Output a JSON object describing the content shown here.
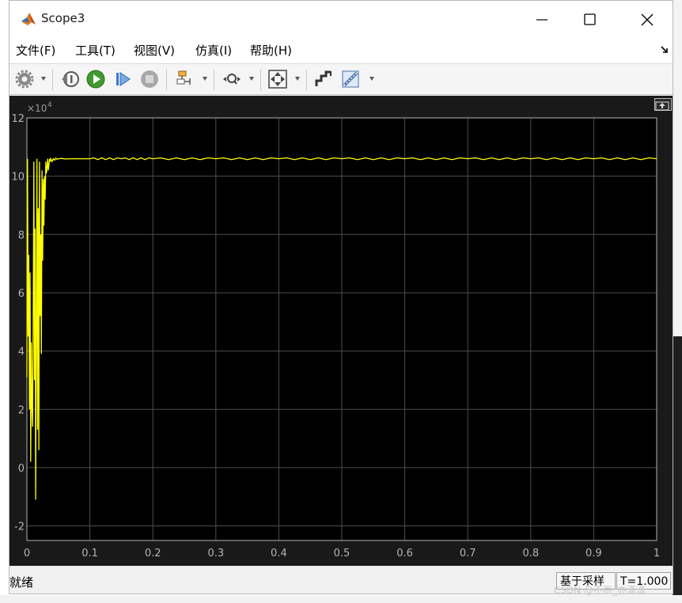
{
  "window": {
    "title": "Scope3",
    "controls": [
      "minimize",
      "maximize",
      "close"
    ]
  },
  "menu": {
    "items": [
      {
        "label": "文件(F)"
      },
      {
        "label": "工具(T)"
      },
      {
        "label": "视图(V)"
      },
      {
        "label": "仿真(I)"
      },
      {
        "label": "帮助(H)"
      }
    ]
  },
  "toolbar": {
    "buttons": [
      "gear-icon",
      "step-back-icon",
      "run-icon",
      "step-forward-icon",
      "stop-icon",
      "signal-selector-icon",
      "zoom-icon",
      "autoscale-icon",
      "highlight-icon",
      "measure-icon"
    ]
  },
  "status": {
    "text": "就绪",
    "sample_mode": "基于采样",
    "time": "T=1.000"
  },
  "watermark": "CSDN @不雨_亦潇潇",
  "chart_data": {
    "type": "line",
    "title": "",
    "xlabel": "",
    "ylabel": "",
    "y_exponent_label": "×10",
    "y_exponent_power": "4",
    "xlim": [
      0,
      1
    ],
    "ylim": [
      -2.5,
      12
    ],
    "x_ticks": [
      "0",
      "0.1",
      "0.2",
      "0.3",
      "0.4",
      "0.5",
      "0.6",
      "0.7",
      "0.8",
      "0.9",
      "1"
    ],
    "y_ticks": [
      "-2",
      "0",
      "2",
      "4",
      "6",
      "8",
      "10",
      "12"
    ],
    "grid": true,
    "background": "#000000",
    "axes_color": "#b3b3b3",
    "line_color": "#ffff00",
    "series": [
      {
        "x": [
          0,
          0.001,
          0.002,
          0.003,
          0.004,
          0.005,
          0.006,
          0.007,
          0.008,
          0.009,
          0.01,
          0.011,
          0.012,
          0.013,
          0.014,
          0.015,
          0.016,
          0.017,
          0.018,
          0.019,
          0.02,
          0.021,
          0.022,
          0.023,
          0.024,
          0.025,
          0.026,
          0.027,
          0.028,
          0.029,
          0.03,
          0.031,
          0.032,
          0.033,
          0.034,
          0.035,
          0.036,
          0.037,
          0.038,
          0.04,
          0.042,
          0.044,
          0.046,
          0.048,
          0.05,
          0.055,
          0.06,
          0.07,
          0.08,
          0.1,
          0.15,
          0.2,
          0.3,
          0.4,
          0.5,
          0.6,
          0.7,
          0.8,
          0.9,
          1.0
        ],
        "y": [
          3.1,
          10.6,
          4.5,
          7.3,
          2.0,
          6.7,
          0.2,
          4.3,
          2.1,
          1.4,
          5.1,
          10.5,
          3.0,
          8.2,
          -1.1,
          4.9,
          10.6,
          1.3,
          8.9,
          0.6,
          10.5,
          5.2,
          8.0,
          3.9,
          10.2,
          7.1,
          9.9,
          8.3,
          10.0,
          9.2,
          10.5,
          10.1,
          10.3,
          10.6,
          10.2,
          10.4,
          10.6,
          10.5,
          10.6,
          10.5,
          10.6,
          10.55,
          10.62,
          10.58,
          10.6,
          10.61,
          10.59,
          10.6,
          10.6,
          10.6,
          10.6,
          10.6,
          10.6,
          10.6,
          10.6,
          10.6,
          10.6,
          10.6,
          10.6,
          10.6
        ]
      }
    ]
  }
}
